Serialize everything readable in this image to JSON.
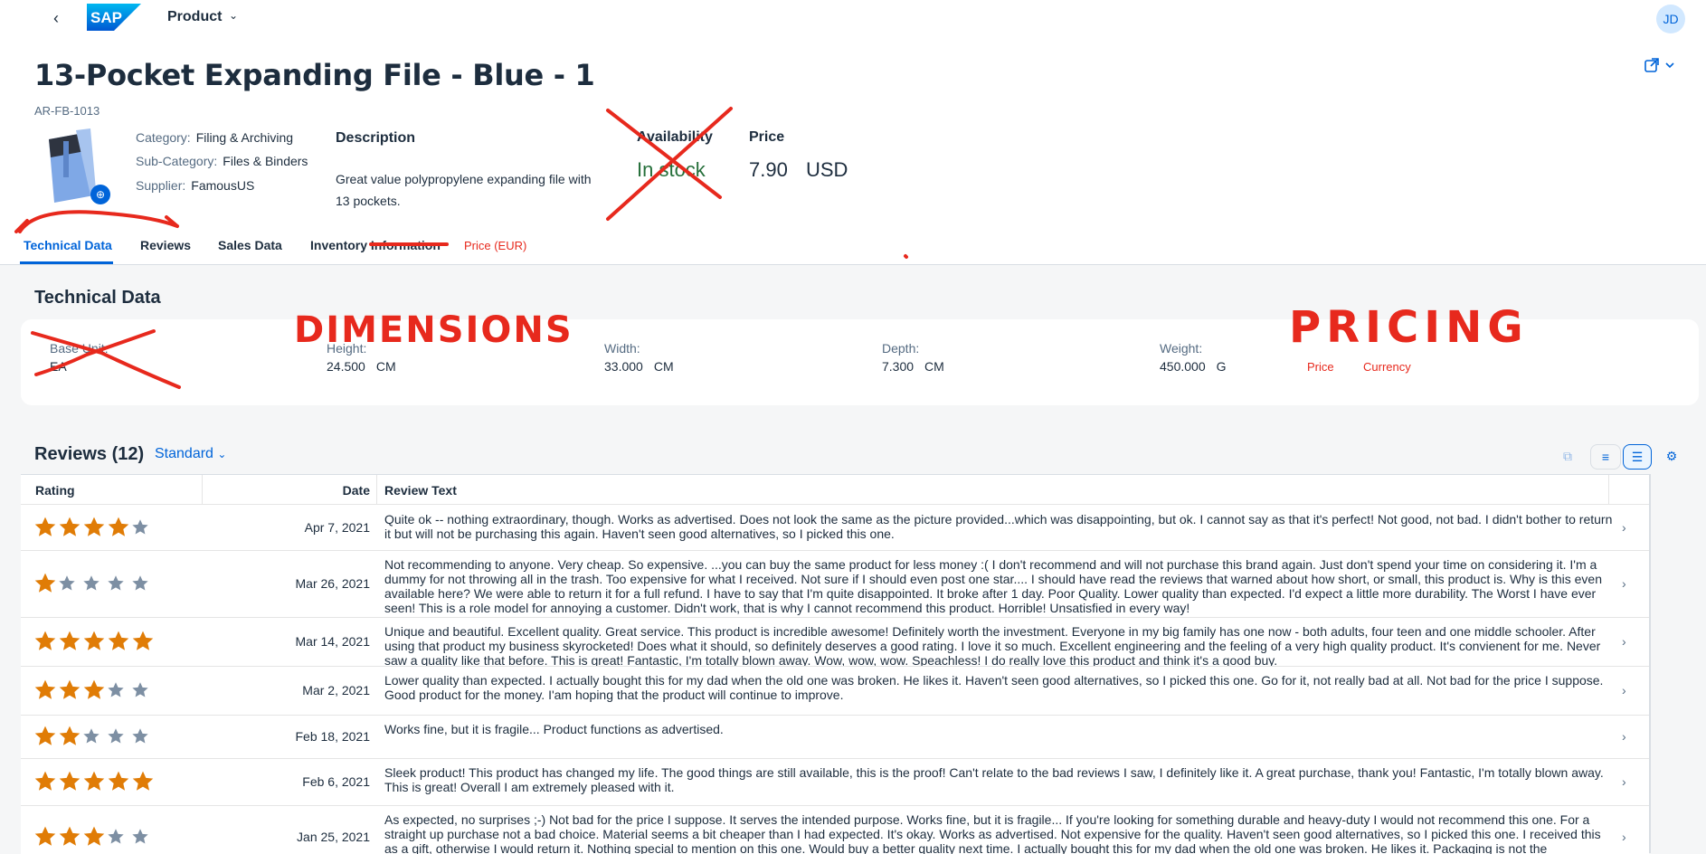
{
  "shell": {
    "app_title": "Product",
    "avatar_initials": "JD"
  },
  "header": {
    "title": "13-Pocket Expanding File - Blue - 1",
    "product_id": "AR-FB-1013",
    "category_label": "Category:",
    "category_value": "Filing & Archiving",
    "subcategory_label": "Sub-Category:",
    "subcategory_value": "Files & Binders",
    "supplier_label": "Supplier:",
    "supplier_value": "FamousUS",
    "description_title": "Description",
    "description_text": "Great value polypropylene expanding file with 13 pockets.",
    "availability_title": "Availability",
    "availability_value": "In stock",
    "price_title": "Price",
    "price_value": "7.90",
    "price_currency": "USD"
  },
  "tabs": [
    {
      "label": "Technical Data",
      "active": true
    },
    {
      "label": "Reviews"
    },
    {
      "label": "Sales Data"
    },
    {
      "label": "Inventory Information"
    },
    {
      "label": "Price (EUR)"
    }
  ],
  "technical": {
    "title": "Technical Data",
    "base_unit_label": "Base Unit:",
    "base_unit_value": "EA",
    "height_label": "Height:",
    "height_value": "24.500",
    "height_unit": "CM",
    "width_label": "Width:",
    "width_value": "33.000",
    "width_unit": "CM",
    "depth_label": "Depth:",
    "depth_value": "7.300",
    "depth_unit": "CM",
    "weight_label": "Weight:",
    "weight_value": "450.000",
    "weight_unit": "G",
    "price_label": "Price",
    "currency_label": "Currency"
  },
  "annotations": {
    "dimensions": "DIMENSIONS",
    "pricing": "PRICING",
    "color": "#e7291d"
  },
  "reviews": {
    "title": "Reviews (12)",
    "variant": "Standard",
    "col_rating": "Rating",
    "col_date": "Date",
    "col_text": "Review Text",
    "rows": [
      {
        "rating": 4,
        "date": "Apr 7, 2021",
        "text": "Quite ok -- nothing extraordinary, though.  Works as advertised.  Does not look the same as the picture provided...which was disappointing, but ok.  I cannot say as that it's perfect!  Not good, not bad.  I didn't bother to return it but will not be purchasing this again.  Haven't seen good alternatives, so I picked this one."
      },
      {
        "rating": 1,
        "date": "Mar 26, 2021",
        "text": "Not recommending to anyone. Very cheap.  So expensive.  ...you can buy the same product for less money :(  I don't recommend and will not purchase this brand again.  Just don't spend your time on considering it.  I'm a dummy for not throwing all in the trash.  Too expensive for what I received.  Not sure if I should even post one star....  I should have read the reviews that warned about how short, or small, this product is.  Why is this even available here?  We were able to return it for a full refund.  I have to say that I'm quite disappointed.  It broke after 1 day. Poor Quality.  Lower quality than expected.  I'd expect a little more durability.  The Worst I have ever seen!  This is a role model for annoying a customer.  Didn't work, that is why I cannot recommend this product.  Horrible! Unsatisfied in every way!"
      },
      {
        "rating": 5,
        "date": "Mar 14, 2021",
        "text": "Unique and beautiful. Excellent quality. Great service.  This product is incredible awesome!  Definitely worth the investment.  Everyone in my big family has one now - both adults, four teen and one middle schooler.  After using that product my business skyrocketed!  Does what it should, so definitely deserves a good rating.  I love it so much.  Excellent engineering and the feeling of a very high quality product.  It's convienent for me.  Never saw a quality like that before.  This is great!  Fantastic, I'm totally blown away.  Wow, wow, wow. Speachless!  I do really love this product and think it's a good buy."
      },
      {
        "rating": 3,
        "date": "Mar 2, 2021",
        "text": "Lower quality than expected.  I actually bought this for my dad when the old one was broken. He likes it.  Haven't seen good alternatives, so I picked this one.  Go for it, not really bad at all.  Not bad for the price I suppose.  Good product for the money.  I'am hoping that the product will continue to improve."
      },
      {
        "rating": 2,
        "date": "Feb 18, 2021",
        "text": "Works fine, but it is fragile...  Product functions as advertised."
      },
      {
        "rating": 5,
        "date": "Feb 6, 2021",
        "text": "Sleek product!  This product has changed my life.  The good things are still available, this is the proof!  Can't relate to the bad reviews I saw, I definitely like it.  A great purchase, thank you!  Fantastic, I'm totally blown away.  This is great!  Overall I am extremely pleased with it."
      },
      {
        "rating": 3,
        "date": "Jan 25, 2021",
        "text": "As expected, no surprises ;-)  Not bad for the price I suppose.  It serves the intended purpose.  Works fine, but it is fragile...  If you're looking for something durable and heavy-duty I would not recommend this one.  For a straight up purchase not a bad choice.  Material seems a bit cheaper than I had expected. It's okay.  Works as advertised.  Not expensive for the quality.  Haven't seen good alternatives, so I picked this one.  I received this as a gift, otherwise I would return it.  Nothing special to mention on this one.  Would buy a better quality next time.  I actually bought this for my dad when the old one was broken. He likes it.  Packaging is not the"
      }
    ]
  }
}
